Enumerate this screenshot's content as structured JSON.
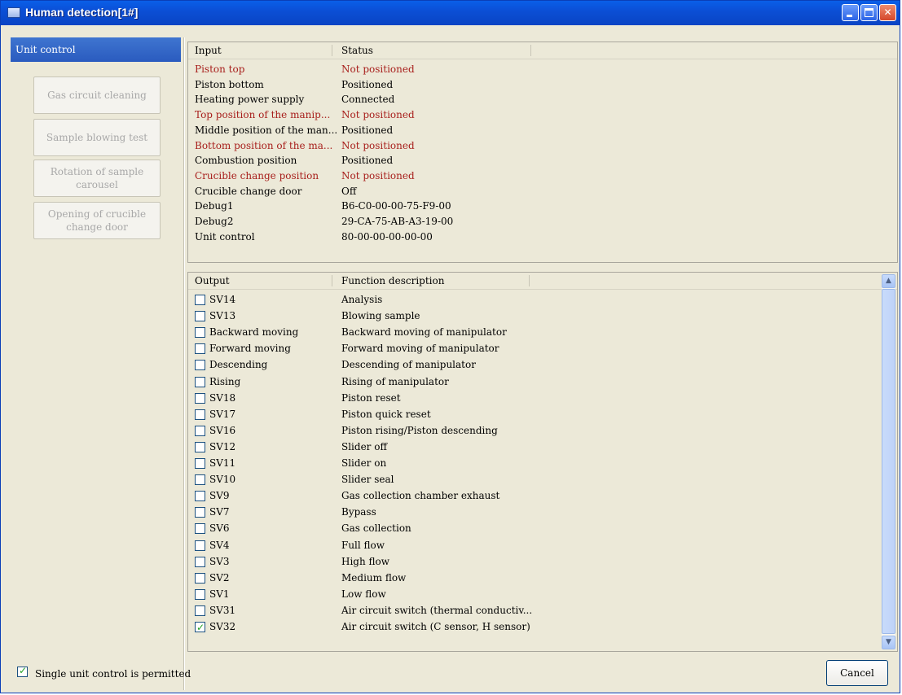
{
  "window": {
    "title": "Human detection[1#]"
  },
  "sidebar": {
    "header": "Unit control",
    "buttons": [
      "Gas circuit cleaning",
      "Sample blowing test",
      "Rotation of sample carousel",
      "Opening of crucible change door"
    ]
  },
  "input_table": {
    "columns": [
      "Input",
      "Status"
    ],
    "rows": [
      {
        "input": "Piston top",
        "status": "Not positioned",
        "alert": true
      },
      {
        "input": "Piston bottom",
        "status": "Positioned",
        "alert": false
      },
      {
        "input": "Heating power supply",
        "status": "Connected",
        "alert": false
      },
      {
        "input": "Top position of the manip...",
        "status": "Not positioned",
        "alert": true
      },
      {
        "input": "Middle position of the man...",
        "status": "Positioned",
        "alert": false
      },
      {
        "input": "Bottom position of the ma...",
        "status": "Not positioned",
        "alert": true
      },
      {
        "input": "Combustion position",
        "status": "Positioned",
        "alert": false
      },
      {
        "input": "Crucible change position",
        "status": "Not positioned",
        "alert": true
      },
      {
        "input": "Crucible change door",
        "status": "Off",
        "alert": false
      },
      {
        "input": "Debug1",
        "status": "B6-C0-00-00-75-F9-00",
        "alert": false
      },
      {
        "input": "Debug2",
        "status": "29-CA-75-AB-A3-19-00",
        "alert": false
      },
      {
        "input": "Unit control",
        "status": "80-00-00-00-00-00",
        "alert": false
      }
    ]
  },
  "output_table": {
    "columns": [
      "Output",
      "Function description"
    ],
    "rows": [
      {
        "output": "SV14",
        "description": "Analysis",
        "checked": false
      },
      {
        "output": "SV13",
        "description": "Blowing sample",
        "checked": false
      },
      {
        "output": "Backward moving",
        "description": "Backward moving of manipulator",
        "checked": false
      },
      {
        "output": "Forward moving",
        "description": "Forward moving of manipulator",
        "checked": false
      },
      {
        "output": "Descending",
        "description": "Descending of manipulator",
        "checked": false
      },
      {
        "output": "Rising",
        "description": "Rising of manipulator",
        "checked": false
      },
      {
        "output": "SV18",
        "description": "Piston reset",
        "checked": false
      },
      {
        "output": "SV17",
        "description": "Piston quick reset",
        "checked": false
      },
      {
        "output": "SV16",
        "description": "Piston rising/Piston descending",
        "checked": false
      },
      {
        "output": "SV12",
        "description": "Slider off",
        "checked": false
      },
      {
        "output": "SV11",
        "description": "Slider on",
        "checked": false
      },
      {
        "output": "SV10",
        "description": "Slider seal",
        "checked": false
      },
      {
        "output": "SV9",
        "description": "Gas collection chamber exhaust",
        "checked": false
      },
      {
        "output": "SV7",
        "description": "Bypass",
        "checked": false
      },
      {
        "output": "SV6",
        "description": "Gas collection",
        "checked": false
      },
      {
        "output": "SV4",
        "description": "Full flow",
        "checked": false
      },
      {
        "output": "SV3",
        "description": "High flow",
        "checked": false
      },
      {
        "output": "SV2",
        "description": "Medium flow",
        "checked": false
      },
      {
        "output": "SV1",
        "description": "Low flow",
        "checked": false
      },
      {
        "output": "SV31",
        "description": "Air circuit switch (thermal conductiv...",
        "checked": false
      },
      {
        "output": "SV32",
        "description": "Air circuit switch (C sensor, H sensor)",
        "checked": true
      }
    ]
  },
  "footer": {
    "single_unit_label": "Single unit control is permitted",
    "single_unit_checked": true,
    "cancel_label": "Cancel"
  },
  "colors": {
    "alert_text": "#a8201d",
    "title_bar": "#0a4fd6",
    "nav_header": "#2a5bbf"
  },
  "icons": {
    "scroll_up": "▲",
    "scroll_down": "▼"
  }
}
